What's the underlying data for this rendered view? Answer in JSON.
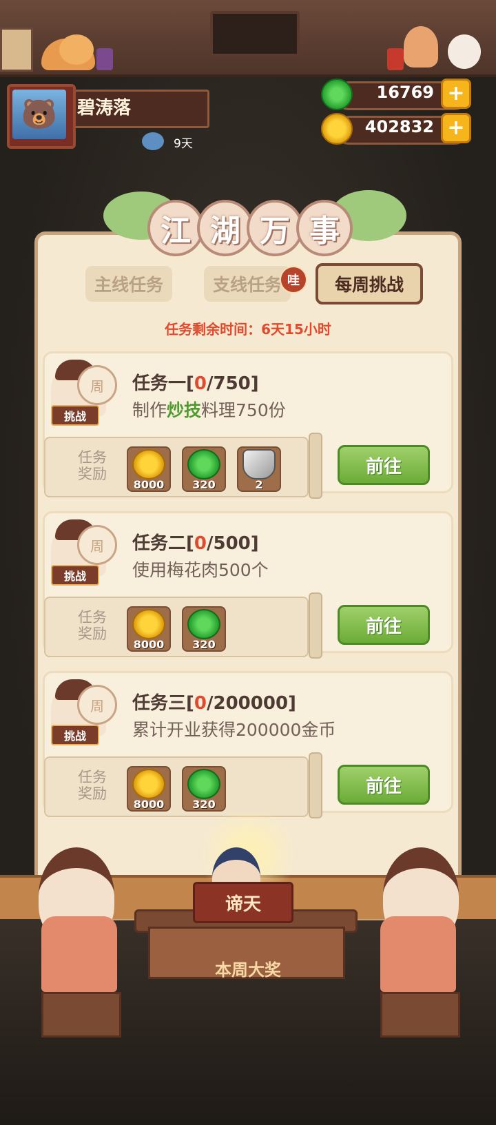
{
  "player": {
    "name": "碧涛落",
    "days": "9天"
  },
  "currency": {
    "jade_amount": "16769",
    "coin_amount": "402832",
    "plus_label": "+"
  },
  "panel": {
    "title_chars": [
      "江",
      "湖",
      "万",
      "事"
    ],
    "tabs": [
      {
        "label": "主线任务",
        "active": false
      },
      {
        "label": "支线任务",
        "active": false,
        "badge": "哇"
      },
      {
        "label": "每周挑战",
        "active": true
      }
    ],
    "timer_label": "任务剩余时间：",
    "timer_value": "6天15小时"
  },
  "challenge_badge": {
    "coin_char": "周",
    "tag_label": "挑战"
  },
  "reward_label_line1": "任务",
  "reward_label_line2": "奖励",
  "go_label": "前往",
  "tasks": [
    {
      "name": "任务一",
      "open": "[",
      "progress": "0",
      "total": "/750]",
      "desc_pre": "制作",
      "desc_hl": "炒技",
      "desc_post": "料理750份",
      "rewards": [
        {
          "type": "coin",
          "amount": "8000"
        },
        {
          "type": "jade",
          "amount": "320"
        },
        {
          "type": "rice-ball",
          "amount": "2"
        }
      ]
    },
    {
      "name": "任务二",
      "open": "[",
      "progress": "0",
      "total": "/500]",
      "desc_pre": "使用梅花肉500个",
      "rewards": [
        {
          "type": "coin",
          "amount": "8000"
        },
        {
          "type": "jade",
          "amount": "320"
        }
      ]
    },
    {
      "name": "任务三",
      "open": "[",
      "progress": "0",
      "total": "/200000]",
      "desc_pre": "累计开业获得200000金币",
      "rewards": [
        {
          "type": "coin",
          "amount": "8000"
        },
        {
          "type": "jade",
          "amount": "320"
        }
      ]
    }
  ],
  "weekly_prize": {
    "sign": "谛天",
    "label": "本周大奖"
  },
  "colors": {
    "accent_red": "#e04a2d",
    "highlight_green": "#4f9b2f",
    "button_green": "#6cab37",
    "panel_bg": "#f5e9d2"
  }
}
